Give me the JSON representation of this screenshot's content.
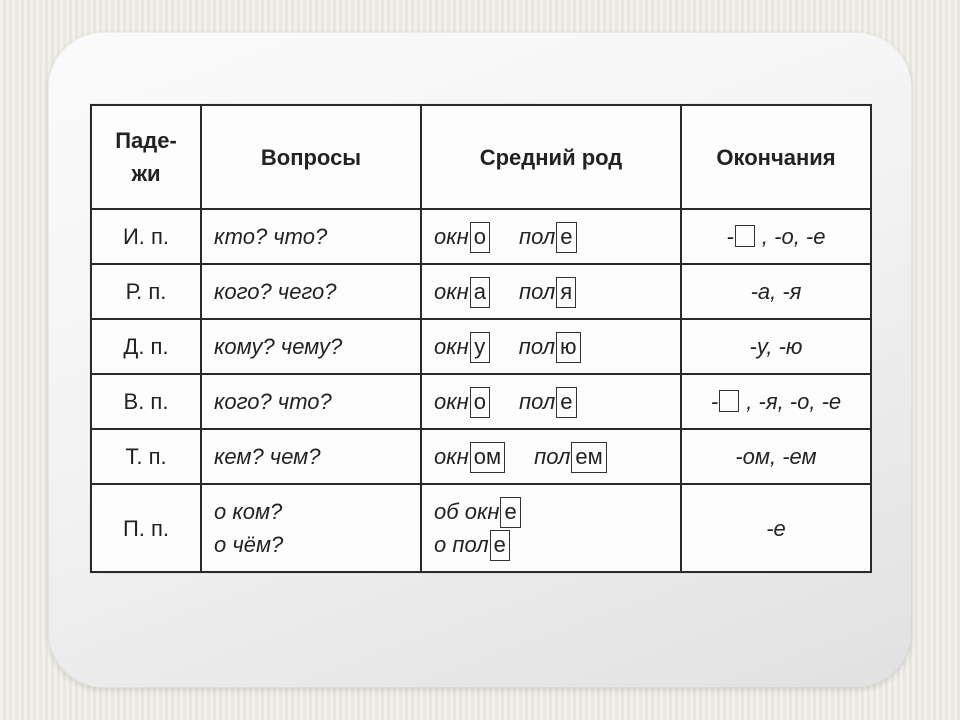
{
  "headers": {
    "cases": "Паде-\nжи",
    "questions": "Вопросы",
    "neuter": "Средний  род",
    "endings": "Окончания"
  },
  "rows": [
    {
      "case": "И.  п.",
      "question": "кто? что?",
      "ex1_stem": "окн",
      "ex1_end": "о",
      "ex2_stem": "пол",
      "ex2_end": "е",
      "endings_prefix": "-",
      "endings_box": true,
      "endings_rest": " ,  -о, -е"
    },
    {
      "case": "Р.  п.",
      "question": "кого? чего?",
      "ex1_stem": "окн",
      "ex1_end": "а",
      "ex2_stem": "пол",
      "ex2_end": "я",
      "endings": "-а, -я"
    },
    {
      "case": "Д.  п.",
      "question": "кому? чему?",
      "ex1_stem": "окн",
      "ex1_end": "у",
      "ex2_stem": "пол",
      "ex2_end": "ю",
      "endings": "-у, -ю"
    },
    {
      "case": "В.  п.",
      "question": "кого? что?",
      "ex1_stem": "окн",
      "ex1_end": "о",
      "ex2_stem": "пол",
      "ex2_end": "е",
      "endings_prefix": "-",
      "endings_box": true,
      "endings_rest": " ,  -я, -о, -е"
    },
    {
      "case": "Т.  п.",
      "question": "кем? чем?",
      "ex1_stem": "окн",
      "ex1_end": "ом",
      "ex2_stem": "пол",
      "ex2_end": "ем",
      "endings": "-ом, -ем"
    },
    {
      "case": "П.  п.",
      "question_line1": "о  ком?",
      "question_line2": "о  чём?",
      "ex1_pre": "об  ",
      "ex1_stem": "окн",
      "ex1_end": "е",
      "ex2_pre": "о  ",
      "ex2_stem": "пол",
      "ex2_end": "е",
      "two_lines_examples": true,
      "endings": "-е"
    }
  ]
}
